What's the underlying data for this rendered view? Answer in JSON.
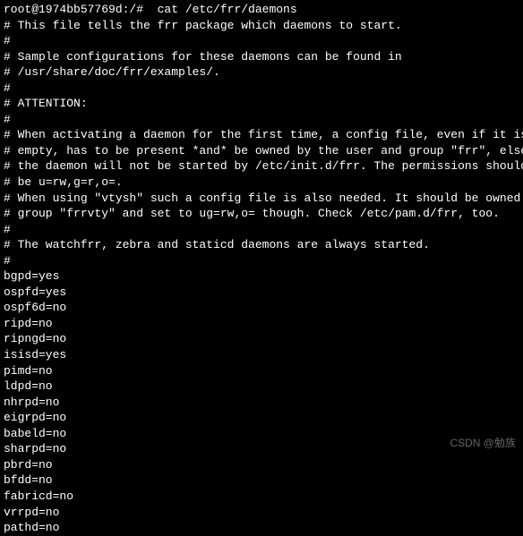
{
  "prompt": {
    "full": "root@1974bb57769d:/#  cat /etc/frr/daemons"
  },
  "comments": [
    "# This file tells the frr package which daemons to start.",
    "#",
    "# Sample configurations for these daemons can be found in",
    "# /usr/share/doc/frr/examples/.",
    "#",
    "# ATTENTION:",
    "#",
    "# When activating a daemon for the first time, a config file, even if it is",
    "# empty, has to be present *and* be owned by the user and group \"frr\", else",
    "# the daemon will not be started by /etc/init.d/frr. The permissions should",
    "# be u=rw,g=r,o=.",
    "# When using \"vtysh\" such a config file is also needed. It should be owned by",
    "# group \"frrvty\" and set to ug=rw,o= though. Check /etc/pam.d/frr, too.",
    "#",
    "# The watchfrr, zebra and staticd daemons are always started.",
    "#"
  ],
  "daemons": [
    {
      "name": "bgpd",
      "value": "yes"
    },
    {
      "name": "ospfd",
      "value": "yes"
    },
    {
      "name": "ospf6d",
      "value": "no"
    },
    {
      "name": "ripd",
      "value": "no"
    },
    {
      "name": "ripngd",
      "value": "no"
    },
    {
      "name": "isisd",
      "value": "yes"
    },
    {
      "name": "pimd",
      "value": "no"
    },
    {
      "name": "ldpd",
      "value": "no"
    },
    {
      "name": "nhrpd",
      "value": "no"
    },
    {
      "name": "eigrpd",
      "value": "no"
    },
    {
      "name": "babeld",
      "value": "no"
    },
    {
      "name": "sharpd",
      "value": "no"
    },
    {
      "name": "pbrd",
      "value": "no"
    },
    {
      "name": "bfdd",
      "value": "no"
    },
    {
      "name": "fabricd",
      "value": "no"
    },
    {
      "name": "vrrpd",
      "value": "no"
    },
    {
      "name": "pathd",
      "value": "no"
    }
  ],
  "watermark": "CSDN @勉族"
}
